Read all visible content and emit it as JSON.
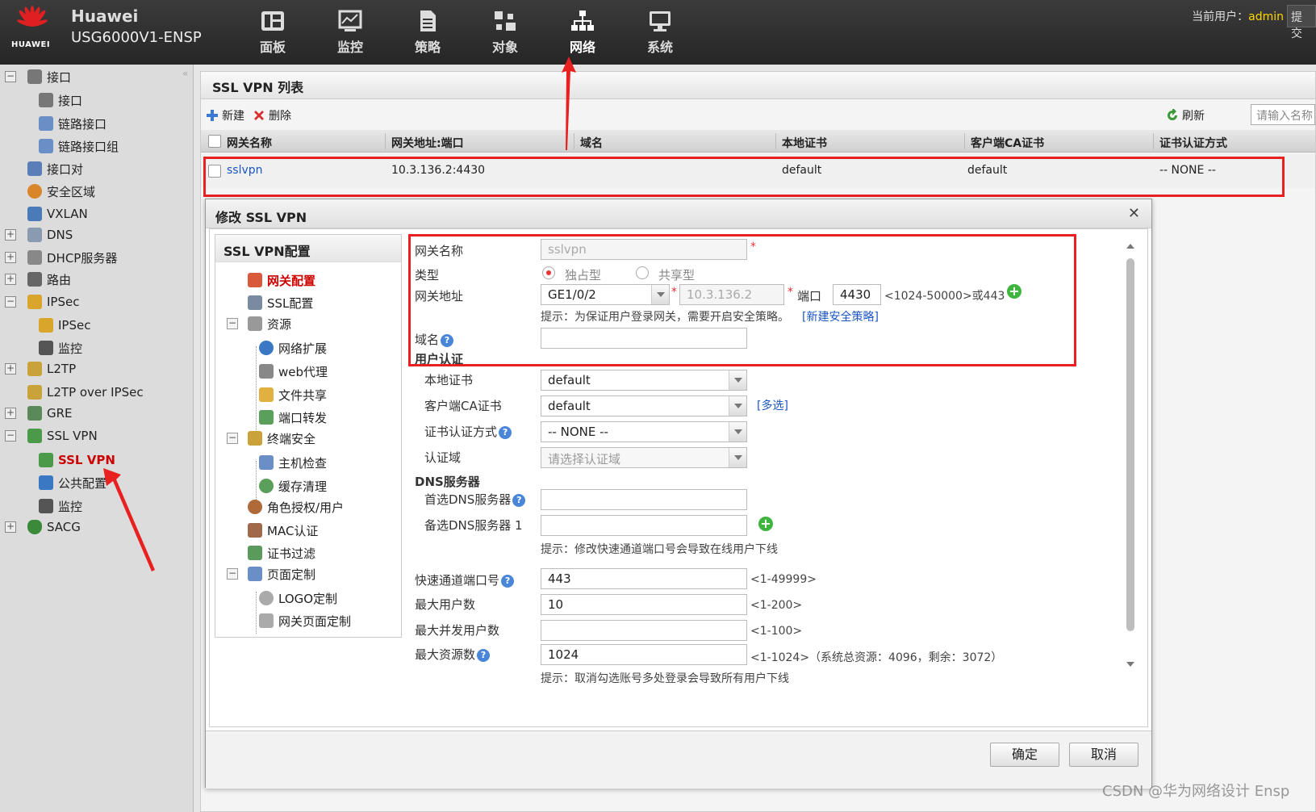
{
  "header": {
    "logo_text": "HUAWEI",
    "brand": "Huawei",
    "model": "USG6000V1-ENSP",
    "nav": [
      {
        "label": "面板",
        "icon": "dashboard-icon"
      },
      {
        "label": "监控",
        "icon": "monitor-icon"
      },
      {
        "label": "策略",
        "icon": "policy-icon"
      },
      {
        "label": "对象",
        "icon": "object-icon"
      },
      {
        "label": "网络",
        "icon": "network-icon"
      },
      {
        "label": "系统",
        "icon": "system-icon"
      }
    ],
    "active_nav": "网络",
    "user_prefix": "当前用户：",
    "user_name": "admin",
    "submit_label": "提交"
  },
  "sidebar": {
    "items": [
      {
        "label": "接口",
        "toggle": "−",
        "icon": "interface-icon"
      },
      {
        "label": "接口",
        "icon": "interface-icon"
      },
      {
        "label": "链路接口",
        "icon": "link-interface-icon"
      },
      {
        "label": "链路接口组",
        "icon": "link-group-icon"
      },
      {
        "label": "接口对",
        "icon": "interface-pair-icon"
      },
      {
        "label": "安全区域",
        "icon": "security-zone-icon"
      },
      {
        "label": "VXLAN",
        "icon": "vxlan-icon"
      },
      {
        "label": "DNS",
        "toggle": "+",
        "icon": "dns-icon"
      },
      {
        "label": "DHCP服务器",
        "toggle": "+",
        "icon": "dhcp-icon"
      },
      {
        "label": "路由",
        "toggle": "+",
        "icon": "route-icon"
      },
      {
        "label": "IPSec",
        "toggle": "−",
        "icon": "ipsec-icon"
      },
      {
        "label": "IPSec",
        "icon": "ipsec-icon"
      },
      {
        "label": "监控",
        "icon": "monitor-icon"
      },
      {
        "label": "L2TP",
        "toggle": "+",
        "icon": "l2tp-icon"
      },
      {
        "label": "L2TP over IPSec",
        "icon": "l2tp-ipsec-icon"
      },
      {
        "label": "GRE",
        "toggle": "+",
        "icon": "gre-icon"
      },
      {
        "label": "SSL VPN",
        "toggle": "−",
        "icon": "sslvpn-icon"
      },
      {
        "label": "SSL VPN",
        "icon": "sslvpn-icon",
        "selected": true
      },
      {
        "label": "公共配置",
        "icon": "public-config-icon"
      },
      {
        "label": "监控",
        "icon": "monitor-icon"
      },
      {
        "label": "SACG",
        "toggle": "+",
        "icon": "sacg-icon"
      }
    ]
  },
  "list": {
    "title": "SSL VPN 列表",
    "new_label": "新建",
    "delete_label": "删除",
    "refresh_label": "刷新",
    "search_placeholder": "请输入名称",
    "columns": [
      "网关名称",
      "网关地址:端口",
      "域名",
      "本地证书",
      "客户端CA证书",
      "证书认证方式"
    ],
    "rows": [
      {
        "name": "sslvpn",
        "address": "10.3.136.2:4430",
        "domain": "",
        "local_cert": "default",
        "ca_cert": "default",
        "auth": "-- NONE --"
      }
    ]
  },
  "dialog": {
    "title": "修改 SSL VPN",
    "nav_title": "SSL VPN配置",
    "nav": [
      {
        "label": "网关配置",
        "active": true,
        "icon": "gateway-config-icon"
      },
      {
        "label": "SSL配置",
        "icon": "ssl-config-icon"
      },
      {
        "label": "资源",
        "toggle": "−",
        "icon": "resource-icon"
      },
      {
        "label": "网络扩展",
        "icon": "network-extension-icon"
      },
      {
        "label": "web代理",
        "icon": "web-proxy-icon"
      },
      {
        "label": "文件共享",
        "icon": "file-share-icon"
      },
      {
        "label": "端口转发",
        "icon": "port-forward-icon"
      },
      {
        "label": "终端安全",
        "toggle": "−",
        "icon": "endpoint-security-icon"
      },
      {
        "label": "主机检查",
        "icon": "host-check-icon"
      },
      {
        "label": "缓存清理",
        "icon": "cache-clean-icon"
      },
      {
        "label": "角色授权/用户",
        "icon": "role-user-icon"
      },
      {
        "label": "MAC认证",
        "icon": "mac-auth-icon"
      },
      {
        "label": "证书过滤",
        "icon": "cert-filter-icon"
      },
      {
        "label": "页面定制",
        "toggle": "−",
        "icon": "page-custom-icon"
      },
      {
        "label": "LOGO定制",
        "icon": "logo-custom-icon"
      },
      {
        "label": "网关页面定制",
        "icon": "gateway-page-icon"
      }
    ],
    "form": {
      "gateway_name_label": "网关名称",
      "gateway_name_value": "sslvpn",
      "type_label": "类型",
      "type_exclusive": "独占型",
      "type_shared": "共享型",
      "gateway_addr_label": "网关地址",
      "interface_value": "GE1/0/2",
      "ip_value": "10.3.136.2",
      "port_label": "端口",
      "port_value": "4430",
      "port_range": "<1024-50000>或443",
      "hint_policy": "提示：为保证用户登录网关，需要开启安全策略。",
      "new_policy_link": "[新建安全策略]",
      "domain_label": "域名",
      "domain_value": "",
      "user_auth_section": "用户认证",
      "local_cert_label": "本地证书",
      "local_cert_value": "default",
      "ca_cert_label": "客户端CA证书",
      "ca_cert_value": "default",
      "multi_select": "[多选]",
      "cert_auth_label": "证书认证方式",
      "cert_auth_value": "-- NONE --",
      "auth_domain_label": "认证域",
      "auth_domain_placeholder": "请选择认证域",
      "dns_section": "DNS服务器",
      "dns_primary_label": "首选DNS服务器",
      "dns_primary_value": "",
      "dns_backup_label": "备选DNS服务器 1",
      "dns_backup_value": "",
      "hint_fast_port": "提示：修改快速通道端口号会导致在线用户下线",
      "fast_port_label": "快速通道端口号",
      "fast_port_value": "443",
      "fast_port_range": "<1-49999>",
      "max_users_label": "最大用户数",
      "max_users_value": "10",
      "max_users_range": "<1-200>",
      "max_concurrent_label": "最大并发用户数",
      "max_concurrent_value": "",
      "max_concurrent_range": "<1-100>",
      "max_resources_label": "最大资源数",
      "max_resources_value": "1024",
      "max_resources_range": "<1-1024>（系统总资源：4096，剩余：3072）",
      "hint_cancel_multi": "提示：取消勾选账号多处登录会导致所有用户下线"
    },
    "ok_label": "确定",
    "cancel_label": "取消"
  },
  "watermark": "CSDN @华为网络设计 Ensp",
  "colors": {
    "highlight": "#e82020",
    "active_text": "#cc0000",
    "link": "#1a55c4",
    "user": "#ffd800"
  }
}
